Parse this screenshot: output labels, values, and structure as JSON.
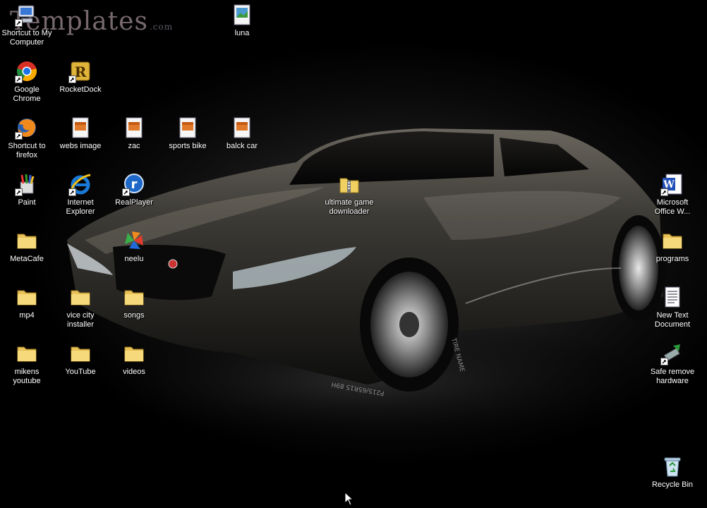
{
  "wallpaper": {
    "watermark_text": "Templates",
    "watermark_suffix": ".com",
    "tire_text_1": "TIRE NAME",
    "tire_text_2": "P215/65R15 89H"
  },
  "icons": [
    {
      "label": "Shortcut to My Computer",
      "icon": "my-computer-icon"
    },
    {
      "label": "luna",
      "icon": "image-file-icon"
    },
    {
      "label": "Google Chrome",
      "icon": "chrome-icon"
    },
    {
      "label": "RocketDock",
      "icon": "rocketdock-icon"
    },
    {
      "label": "Shortcut to firefox",
      "icon": "firefox-icon"
    },
    {
      "label": "webs image",
      "icon": "image-file-icon"
    },
    {
      "label": "zac",
      "icon": "image-file-icon"
    },
    {
      "label": "sports bike",
      "icon": "image-file-icon"
    },
    {
      "label": "balck car",
      "icon": "image-file-icon"
    },
    {
      "label": "Paint",
      "icon": "paint-icon"
    },
    {
      "label": "Internet Explorer",
      "icon": "internet-explorer-icon"
    },
    {
      "label": "RealPlayer",
      "icon": "realplayer-icon"
    },
    {
      "label": "ultimate game downloader",
      "icon": "zip-folder-icon"
    },
    {
      "label": "Microsoft Office W...",
      "icon": "word-icon"
    },
    {
      "label": "MetaCafe",
      "icon": "folder-icon"
    },
    {
      "label": "neelu",
      "icon": "msn-icon"
    },
    {
      "label": "programs",
      "icon": "folder-icon"
    },
    {
      "label": "mp4",
      "icon": "folder-icon"
    },
    {
      "label": "vice city installer",
      "icon": "folder-icon"
    },
    {
      "label": "songs",
      "icon": "folder-icon"
    },
    {
      "label": "New Text Document",
      "icon": "text-document-icon"
    },
    {
      "label": "mikens youtube",
      "icon": "folder-icon"
    },
    {
      "label": "YouTube",
      "icon": "folder-icon"
    },
    {
      "label": "videos",
      "icon": "folder-icon"
    },
    {
      "label": "Safe remove hardware",
      "icon": "safe-remove-hardware-icon"
    },
    {
      "label": "Recycle Bin",
      "icon": "recycle-bin-icon"
    }
  ]
}
